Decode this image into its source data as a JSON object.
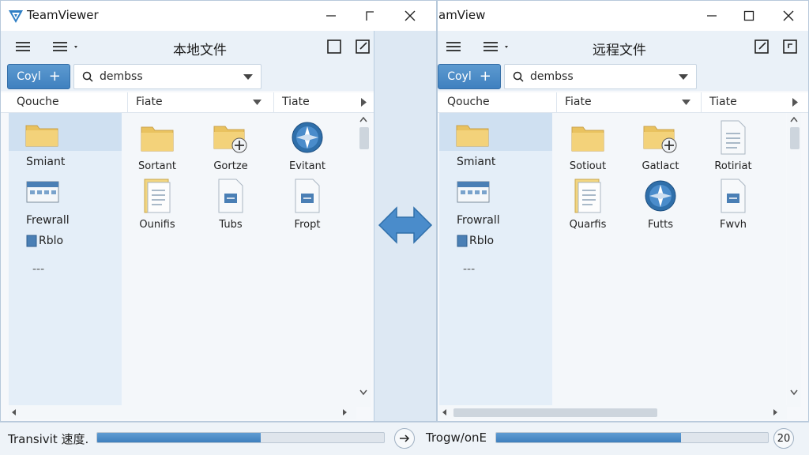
{
  "colors": {
    "accent": "#4a8ccb",
    "nav_bg": "#e4eef8",
    "selection": "#cfe0f1",
    "folder": "#f3d27a"
  },
  "left_window": {
    "app_title": "TeamViewer",
    "pane_title": "本地文件",
    "copy_label": "Coyl",
    "search_value": "dembss",
    "columns": [
      "Qouche",
      "Fiate",
      "Tiate"
    ],
    "nav": [
      {
        "label": "Smiant",
        "icon": "folder-icon"
      },
      {
        "label": "Frewrall",
        "icon": "computer-icon"
      },
      {
        "label": "Rblo",
        "icon": "file-icon"
      },
      {
        "label": "---",
        "icon": ""
      }
    ],
    "files": [
      {
        "label": "Sortant",
        "icon": "folder-icon"
      },
      {
        "label": "Gortze",
        "icon": "folder-sync-icon"
      },
      {
        "label": "Evitant",
        "icon": "compass-icon"
      },
      {
        "label": "Ounifis",
        "icon": "document-icon"
      },
      {
        "label": "Tubs",
        "icon": "document-icon"
      },
      {
        "label": "Fropt",
        "icon": "document-icon"
      }
    ]
  },
  "right_window": {
    "app_title": "amView",
    "pane_title": "远程文件",
    "copy_label": "Coyl",
    "search_value": "dembss",
    "columns": [
      "Qouche",
      "Fiate",
      "Tiate"
    ],
    "nav": [
      {
        "label": "Smiant",
        "icon": "folder-icon"
      },
      {
        "label": "Frowrall",
        "icon": "computer-icon"
      },
      {
        "label": "Rblo",
        "icon": "file-icon"
      },
      {
        "label": "---",
        "icon": ""
      }
    ],
    "files": [
      {
        "label": "Sotiout",
        "icon": "folder-icon"
      },
      {
        "label": "Gatlact",
        "icon": "folder-sync-icon"
      },
      {
        "label": "Rotiriat",
        "icon": "document-icon"
      },
      {
        "label": "Quarfis",
        "icon": "document-icon"
      },
      {
        "label": "Futts",
        "icon": "compass-icon"
      },
      {
        "label": "Fwvh",
        "icon": "document-icon"
      }
    ]
  },
  "status": {
    "left_label": "Transivit 速度.",
    "left_progress": 0.57,
    "right_label": "Trogw/onE",
    "right_progress": 0.68,
    "right_badge": "20"
  }
}
